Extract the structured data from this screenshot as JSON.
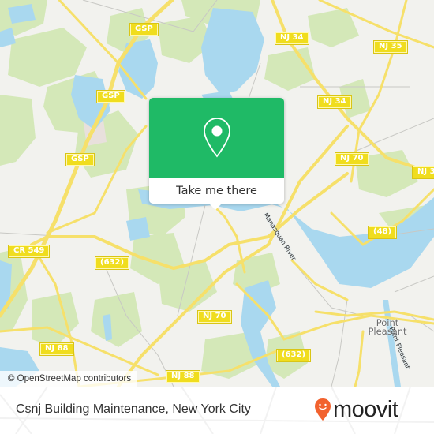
{
  "map": {
    "colors": {
      "background": "#f2f2ee",
      "water": "#a9d8ef",
      "park": "#d4e8b8",
      "road_major": "#f6e06a",
      "road_minor": "#c8c8c4",
      "shield": "#f0dd1e"
    },
    "shields": [
      {
        "label": "GSP"
      },
      {
        "label": "GSP"
      },
      {
        "label": "GSP"
      },
      {
        "label": "NJ 34"
      },
      {
        "label": "NJ 34"
      },
      {
        "label": "NJ 35"
      },
      {
        "label": "NJ 70"
      },
      {
        "label": "NJ 3"
      },
      {
        "label": "CR 549"
      },
      {
        "label": "(632)"
      },
      {
        "label": "(48)"
      },
      {
        "label": "NJ 70"
      },
      {
        "label": "NJ 88"
      },
      {
        "label": "(632)"
      },
      {
        "label": "NJ 88"
      }
    ],
    "places": [
      {
        "label": "Point Pleasant"
      }
    ],
    "water_labels": [
      {
        "label": "Manasquan River"
      },
      {
        "label": "Point Pleasant"
      }
    ],
    "attribution": "© OpenStreetMap contributors"
  },
  "popup": {
    "icon": "map-pin-icon",
    "action_label": "Take me there",
    "color": "#1fba66"
  },
  "footer": {
    "place_title": "Csnj Building Maintenance, New York City",
    "brand": "moovit",
    "brand_color": "#f2622e"
  }
}
